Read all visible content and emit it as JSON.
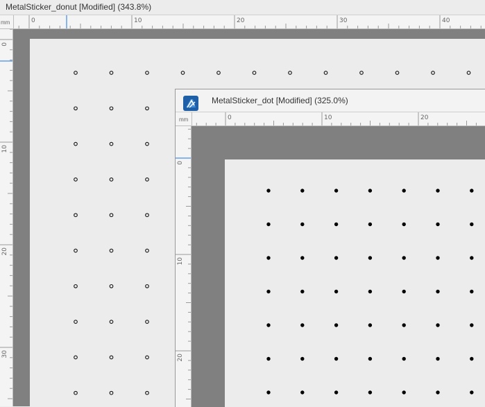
{
  "windows": {
    "back": {
      "title": "MetalSticker_donut [Modified]",
      "zoom": "(343.8%)",
      "ruler_unit": "mm",
      "h_ruler_labels": [
        "0",
        "10",
        "20",
        "30",
        "40"
      ],
      "v_ruler_labels": [
        "0",
        "10",
        "20",
        "30"
      ],
      "marker_style": "ring",
      "marker_grid": {
        "rows": 10,
        "first_row_columns": 12,
        "other_row_columns": 3
      }
    },
    "front": {
      "title": "MetalSticker_dot [Modified]",
      "zoom": "(325.0%)",
      "ruler_unit": "mm",
      "h_ruler_labels": [
        "0",
        "10",
        "20"
      ],
      "v_ruler_labels": [
        "0",
        "10",
        "20"
      ],
      "marker_style": "filled-dot",
      "marker_grid": {
        "rows": 7,
        "columns": 7
      },
      "app_icon": "affinity-designer-icon"
    }
  },
  "colors": {
    "pasteboard": "#808080",
    "canvas": "#ececec",
    "app_icon_bg": "#1f5fa8",
    "ruler_guide": "#1a73e8"
  }
}
